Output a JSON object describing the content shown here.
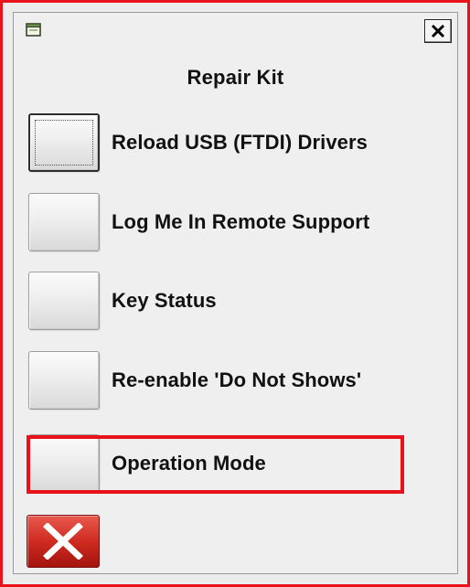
{
  "window": {
    "title": "Repair Kit"
  },
  "buttons": [
    {
      "label": "Reload USB (FTDI) Drivers"
    },
    {
      "label": "Log Me In Remote Support"
    },
    {
      "label": "Key Status"
    },
    {
      "label": "Re-enable 'Do Not Shows'"
    },
    {
      "label": "Operation Mode"
    }
  ],
  "icons": {
    "app": "window-icon",
    "close": "close-icon",
    "exit": "red-x-icon"
  },
  "colors": {
    "highlight": "#e8131a",
    "exit_button": "#d02b20",
    "window_bg": "#efefef"
  }
}
